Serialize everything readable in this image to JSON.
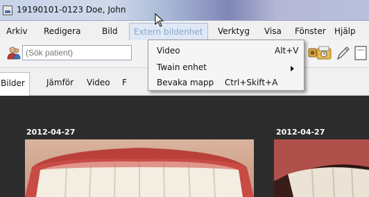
{
  "window": {
    "title": "19190101-0123 Doe, John"
  },
  "menubar": {
    "items": [
      "Arkiv",
      "Redigera",
      "Bild",
      "Extern bildenhet",
      "Verktyg",
      "Visa",
      "Fönster",
      "Hjälp"
    ]
  },
  "toolbar": {
    "search_placeholder": "(Sök patient)"
  },
  "tabs": [
    "Bilder",
    "Jämför",
    "Video",
    "F"
  ],
  "images": [
    {
      "date": "2012-04-27"
    },
    {
      "date": "2012-04-27"
    }
  ],
  "dropdown": {
    "items": [
      {
        "label": "Video",
        "shortcut": "Alt+V"
      },
      {
        "label": "Twain enhet",
        "shortcut": ""
      },
      {
        "label": "Bevaka mapp",
        "shortcut": "Ctrl+Skift+A"
      }
    ]
  }
}
